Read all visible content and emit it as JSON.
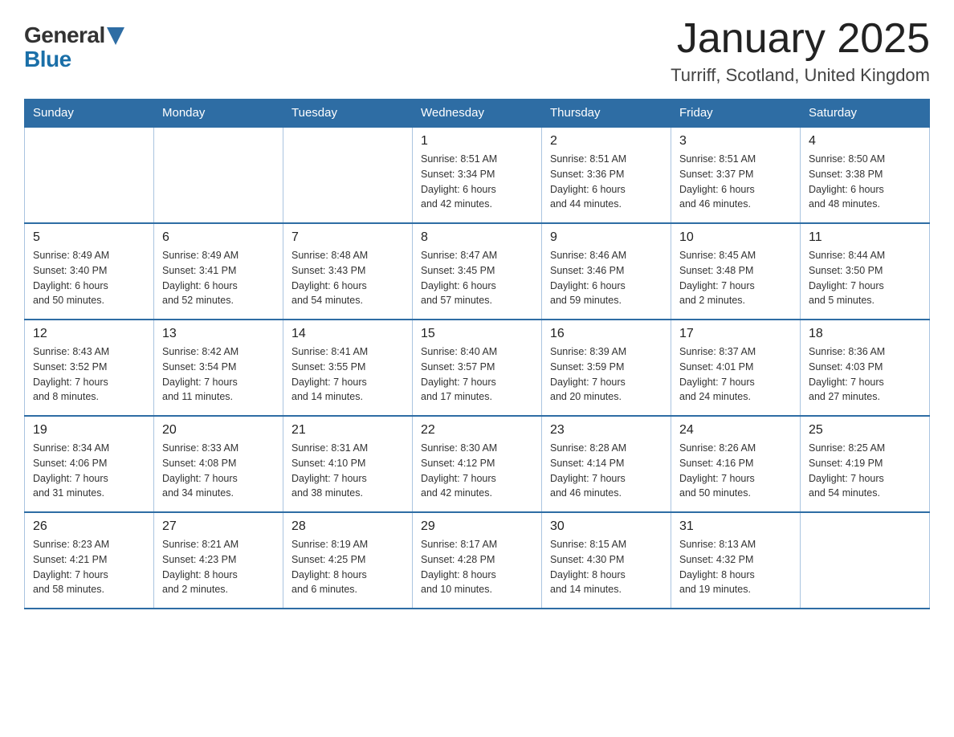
{
  "header": {
    "logo_general": "General",
    "logo_blue": "Blue",
    "title": "January 2025",
    "subtitle": "Turriff, Scotland, United Kingdom"
  },
  "days_of_week": [
    "Sunday",
    "Monday",
    "Tuesday",
    "Wednesday",
    "Thursday",
    "Friday",
    "Saturday"
  ],
  "weeks": [
    [
      {
        "day": "",
        "info": ""
      },
      {
        "day": "",
        "info": ""
      },
      {
        "day": "",
        "info": ""
      },
      {
        "day": "1",
        "info": "Sunrise: 8:51 AM\nSunset: 3:34 PM\nDaylight: 6 hours\nand 42 minutes."
      },
      {
        "day": "2",
        "info": "Sunrise: 8:51 AM\nSunset: 3:36 PM\nDaylight: 6 hours\nand 44 minutes."
      },
      {
        "day": "3",
        "info": "Sunrise: 8:51 AM\nSunset: 3:37 PM\nDaylight: 6 hours\nand 46 minutes."
      },
      {
        "day": "4",
        "info": "Sunrise: 8:50 AM\nSunset: 3:38 PM\nDaylight: 6 hours\nand 48 minutes."
      }
    ],
    [
      {
        "day": "5",
        "info": "Sunrise: 8:49 AM\nSunset: 3:40 PM\nDaylight: 6 hours\nand 50 minutes."
      },
      {
        "day": "6",
        "info": "Sunrise: 8:49 AM\nSunset: 3:41 PM\nDaylight: 6 hours\nand 52 minutes."
      },
      {
        "day": "7",
        "info": "Sunrise: 8:48 AM\nSunset: 3:43 PM\nDaylight: 6 hours\nand 54 minutes."
      },
      {
        "day": "8",
        "info": "Sunrise: 8:47 AM\nSunset: 3:45 PM\nDaylight: 6 hours\nand 57 minutes."
      },
      {
        "day": "9",
        "info": "Sunrise: 8:46 AM\nSunset: 3:46 PM\nDaylight: 6 hours\nand 59 minutes."
      },
      {
        "day": "10",
        "info": "Sunrise: 8:45 AM\nSunset: 3:48 PM\nDaylight: 7 hours\nand 2 minutes."
      },
      {
        "day": "11",
        "info": "Sunrise: 8:44 AM\nSunset: 3:50 PM\nDaylight: 7 hours\nand 5 minutes."
      }
    ],
    [
      {
        "day": "12",
        "info": "Sunrise: 8:43 AM\nSunset: 3:52 PM\nDaylight: 7 hours\nand 8 minutes."
      },
      {
        "day": "13",
        "info": "Sunrise: 8:42 AM\nSunset: 3:54 PM\nDaylight: 7 hours\nand 11 minutes."
      },
      {
        "day": "14",
        "info": "Sunrise: 8:41 AM\nSunset: 3:55 PM\nDaylight: 7 hours\nand 14 minutes."
      },
      {
        "day": "15",
        "info": "Sunrise: 8:40 AM\nSunset: 3:57 PM\nDaylight: 7 hours\nand 17 minutes."
      },
      {
        "day": "16",
        "info": "Sunrise: 8:39 AM\nSunset: 3:59 PM\nDaylight: 7 hours\nand 20 minutes."
      },
      {
        "day": "17",
        "info": "Sunrise: 8:37 AM\nSunset: 4:01 PM\nDaylight: 7 hours\nand 24 minutes."
      },
      {
        "day": "18",
        "info": "Sunrise: 8:36 AM\nSunset: 4:03 PM\nDaylight: 7 hours\nand 27 minutes."
      }
    ],
    [
      {
        "day": "19",
        "info": "Sunrise: 8:34 AM\nSunset: 4:06 PM\nDaylight: 7 hours\nand 31 minutes."
      },
      {
        "day": "20",
        "info": "Sunrise: 8:33 AM\nSunset: 4:08 PM\nDaylight: 7 hours\nand 34 minutes."
      },
      {
        "day": "21",
        "info": "Sunrise: 8:31 AM\nSunset: 4:10 PM\nDaylight: 7 hours\nand 38 minutes."
      },
      {
        "day": "22",
        "info": "Sunrise: 8:30 AM\nSunset: 4:12 PM\nDaylight: 7 hours\nand 42 minutes."
      },
      {
        "day": "23",
        "info": "Sunrise: 8:28 AM\nSunset: 4:14 PM\nDaylight: 7 hours\nand 46 minutes."
      },
      {
        "day": "24",
        "info": "Sunrise: 8:26 AM\nSunset: 4:16 PM\nDaylight: 7 hours\nand 50 minutes."
      },
      {
        "day": "25",
        "info": "Sunrise: 8:25 AM\nSunset: 4:19 PM\nDaylight: 7 hours\nand 54 minutes."
      }
    ],
    [
      {
        "day": "26",
        "info": "Sunrise: 8:23 AM\nSunset: 4:21 PM\nDaylight: 7 hours\nand 58 minutes."
      },
      {
        "day": "27",
        "info": "Sunrise: 8:21 AM\nSunset: 4:23 PM\nDaylight: 8 hours\nand 2 minutes."
      },
      {
        "day": "28",
        "info": "Sunrise: 8:19 AM\nSunset: 4:25 PM\nDaylight: 8 hours\nand 6 minutes."
      },
      {
        "day": "29",
        "info": "Sunrise: 8:17 AM\nSunset: 4:28 PM\nDaylight: 8 hours\nand 10 minutes."
      },
      {
        "day": "30",
        "info": "Sunrise: 8:15 AM\nSunset: 4:30 PM\nDaylight: 8 hours\nand 14 minutes."
      },
      {
        "day": "31",
        "info": "Sunrise: 8:13 AM\nSunset: 4:32 PM\nDaylight: 8 hours\nand 19 minutes."
      },
      {
        "day": "",
        "info": ""
      }
    ]
  ]
}
